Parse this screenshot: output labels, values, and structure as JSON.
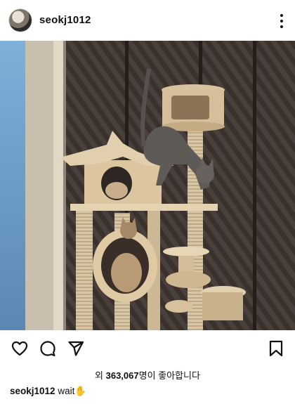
{
  "post": {
    "username": "seokj1012",
    "likes_prefix": "외 ",
    "likes_count": "363,067",
    "likes_suffix": "명이 좋아합니다",
    "caption_username": "seokj1012",
    "caption_text": "wait",
    "caption_emoji": "✋"
  },
  "icons": [
    "more-options-icon",
    "heart-icon",
    "comment-icon",
    "share-icon",
    "bookmark-icon"
  ]
}
